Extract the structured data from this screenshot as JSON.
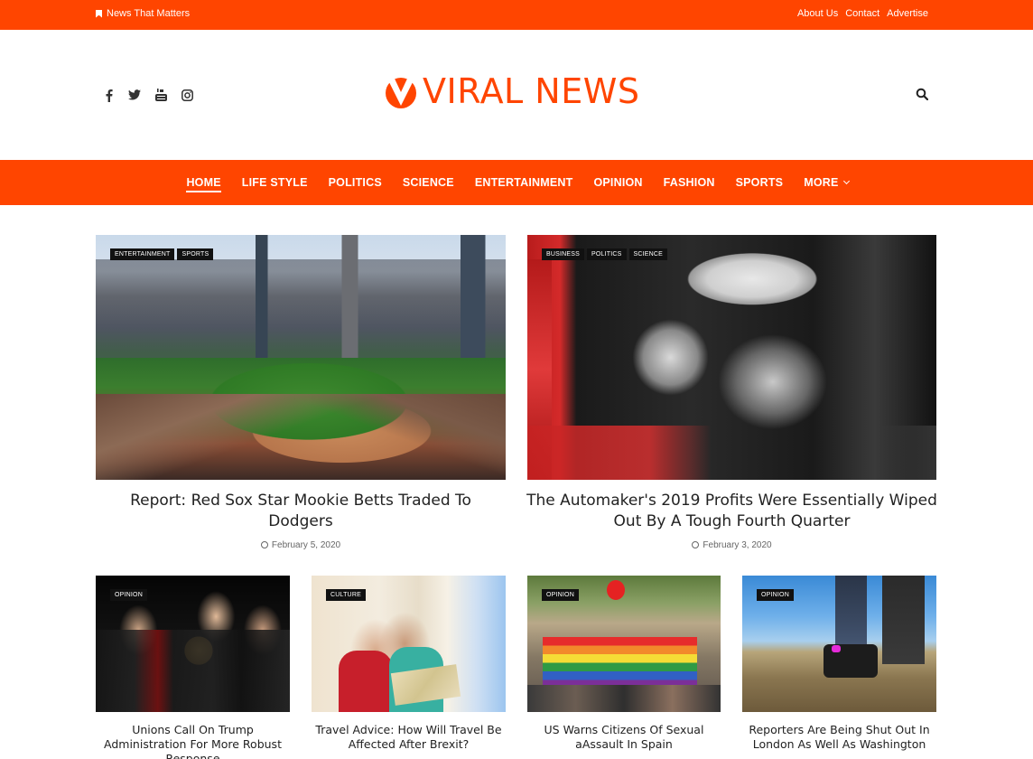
{
  "topbar": {
    "tagline": "News That Matters",
    "links": [
      "About Us",
      "Contact",
      "Advertise"
    ]
  },
  "header": {
    "logo_text": "VIRAL NEWS",
    "social_icons": [
      "facebook-icon",
      "twitter-icon",
      "youtube-icon",
      "instagram-icon"
    ],
    "search_icon": "search-icon"
  },
  "nav": {
    "items": [
      "HOME",
      "LIFE STYLE",
      "POLITICS",
      "SCIENCE",
      "ENTERTAINMENT",
      "OPINION",
      "FASHION",
      "SPORTS",
      "MORE"
    ],
    "active": "HOME"
  },
  "colors": {
    "accent": "#ff4500"
  },
  "featured": [
    {
      "tags": [
        "ENTERTAINMENT",
        "SPORTS"
      ],
      "title": "Report: Red Sox Star Mookie Betts Traded To Dodgers",
      "date": "February 5, 2020"
    },
    {
      "tags": [
        "BUSINESS",
        "POLITICS",
        "SCIENCE"
      ],
      "title": "The Automaker's 2019 Profits Were Essentially Wiped Out By A Tough Fourth Quarter",
      "date": "February 3, 2020"
    }
  ],
  "grid": [
    {
      "tag": "OPINION",
      "title": "Unions Call On Trump Administration For More Robust Response"
    },
    {
      "tag": "CULTURE",
      "title": "Travel Advice: How Will Travel Be Affected After Brexit?"
    },
    {
      "tag": "OPINION",
      "title": "US Warns Citizens Of Sexual aAssault In Spain"
    },
    {
      "tag": "OPINION",
      "title": "Reporters Are Being Shut Out In London As Well As Washington"
    }
  ]
}
